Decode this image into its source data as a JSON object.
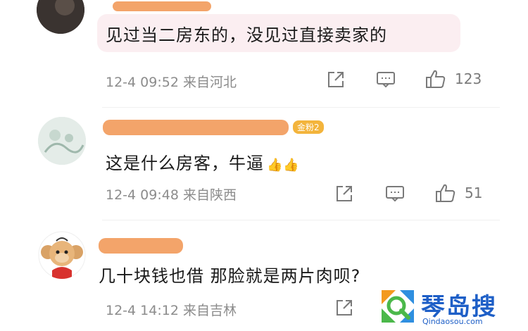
{
  "comments": [
    {
      "text": "见过当二房东的，没见过直接卖家的",
      "meta": "12-4 09:52 来自河北",
      "likes": "123"
    },
    {
      "fan_badge": "金粉2",
      "text": "这是什么房客，牛逼",
      "emoji": "👍👍",
      "meta": "12-4 09:48 来自陕西",
      "likes": "51"
    },
    {
      "text": "几十块钱也借 那脸就是两片肉呗?",
      "meta": "12-4 14:12 来自吉林"
    }
  ],
  "watermark": {
    "title": "琴岛搜",
    "url": "Qindaosou.com"
  },
  "colors": {
    "bubble": "#fbeef1",
    "redaction": "#f29a5a",
    "icon": "#7a7a7a",
    "meta": "#8c8c8c",
    "watermark": "#1e5fc7"
  }
}
